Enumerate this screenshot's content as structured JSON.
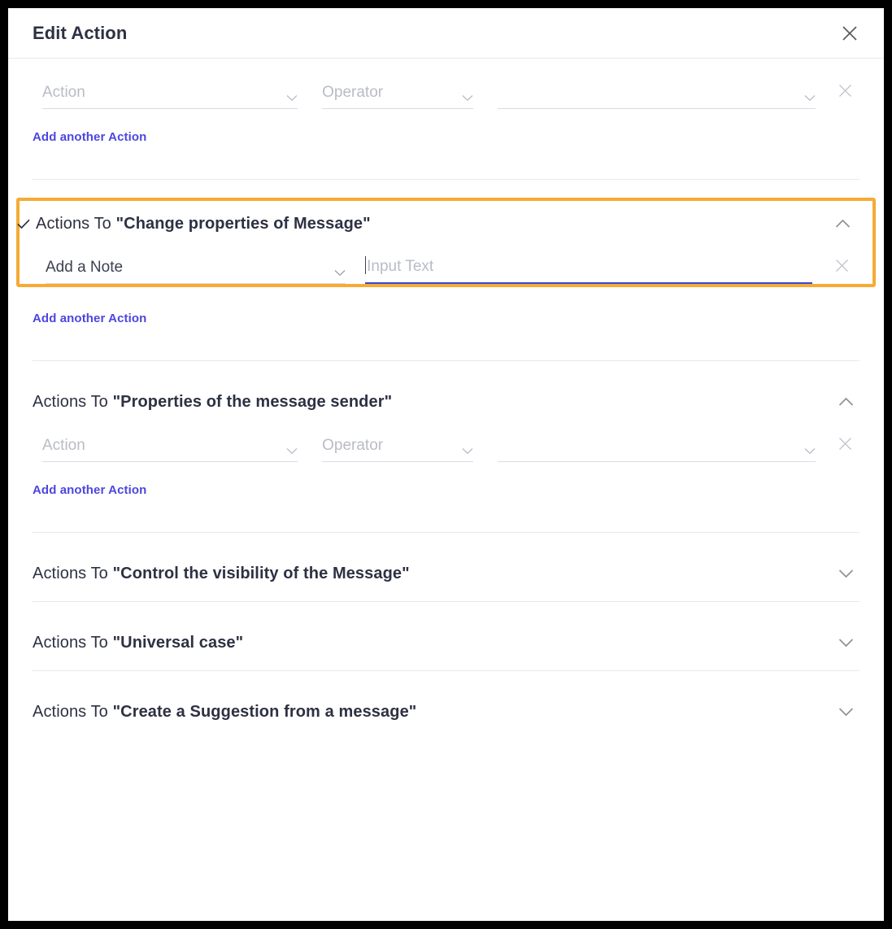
{
  "window": {
    "title": "Edit Action",
    "close_icon": "close-icon"
  },
  "colors": {
    "highlight_border": "#f5ab35",
    "link": "#4c46e0",
    "focus_underline": "#3b44d6",
    "title_text": "#2d3142",
    "placeholder": "#b9bcc6",
    "divider": "#e8e8ec"
  },
  "labels": {
    "actions_to_prefix": "Actions To",
    "add_another_action": "Add another Action",
    "remove_icon": "close-icon",
    "chevron_down_icon": "chevron-down-icon",
    "chevron_up_icon": "chevron-up-icon",
    "check_icon": "check-icon"
  },
  "fields": {
    "action_placeholder": "Action",
    "operator_placeholder": "Operator",
    "value_placeholder": "",
    "note_value": "Add a Note",
    "input_text_placeholder": "Input Text"
  },
  "sections": [
    {
      "id": "top-action-group",
      "has_header": false,
      "expanded": true,
      "checked": false,
      "title_quoted": "",
      "add_link": "Add another Action"
    },
    {
      "id": "change-properties-of-message",
      "has_header": true,
      "expanded": true,
      "checked": true,
      "highlighted": true,
      "title_prefix": "Actions To",
      "title_quoted": "\"Change properties of Message\"",
      "add_link": "Add another Action"
    },
    {
      "id": "properties-of-the-message-sender",
      "has_header": true,
      "expanded": true,
      "checked": false,
      "highlighted": false,
      "title_prefix": "Actions To",
      "title_quoted": "\"Properties of the message sender\"",
      "add_link": "Add another Action"
    },
    {
      "id": "control-the-visibility-of-the-message",
      "has_header": true,
      "expanded": false,
      "checked": false,
      "highlighted": false,
      "title_prefix": "Actions To",
      "title_quoted": "\"Control the visibility of the Message\""
    },
    {
      "id": "universal-case",
      "has_header": true,
      "expanded": false,
      "checked": false,
      "highlighted": false,
      "title_prefix": "Actions To",
      "title_quoted": "\"Universal case\""
    },
    {
      "id": "create-a-suggestion-from-a-message",
      "has_header": true,
      "expanded": false,
      "checked": false,
      "highlighted": false,
      "title_prefix": "Actions To",
      "title_quoted": "\"Create a Suggestion from a message\""
    }
  ]
}
